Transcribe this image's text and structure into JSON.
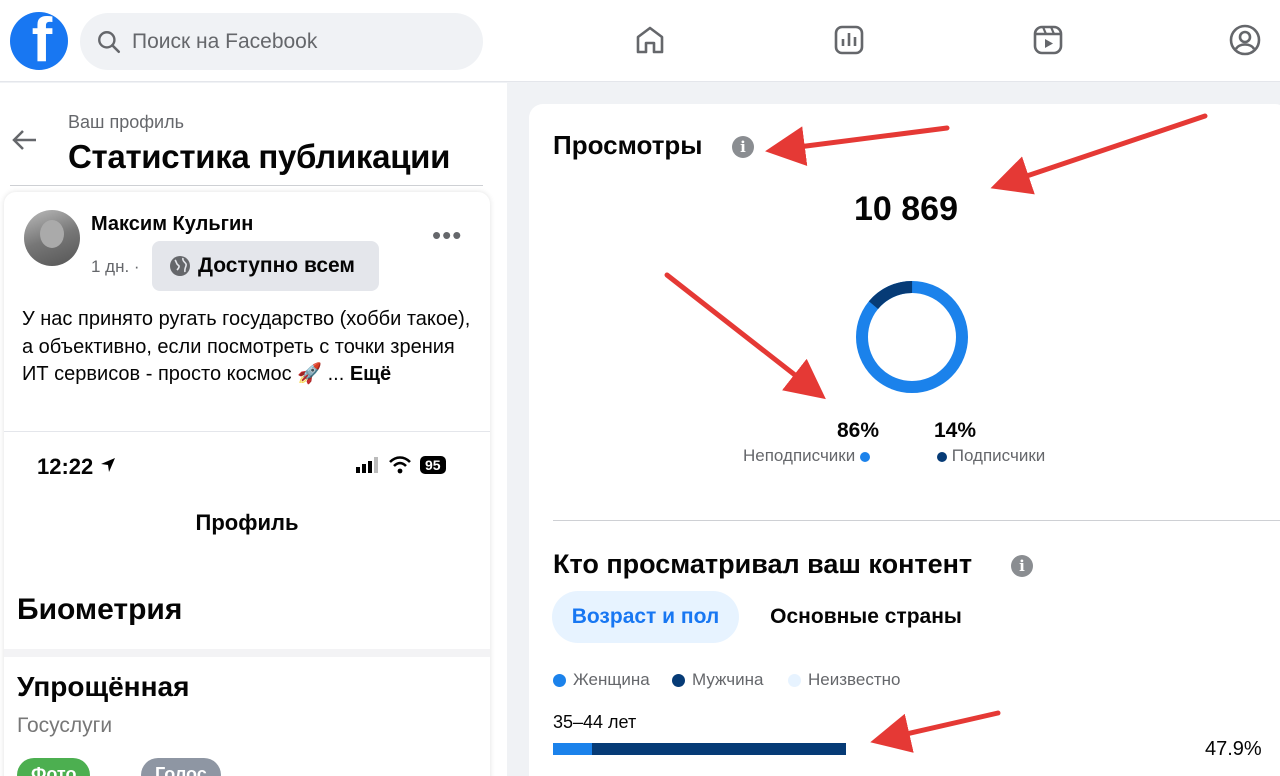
{
  "topbar": {
    "logo_letter": "f",
    "search_placeholder": "Поиск на Facebook",
    "nav_icons": [
      "home-icon",
      "insights-icon",
      "reels-icon",
      "profile-icon"
    ]
  },
  "left": {
    "breadcrumb": "Ваш профиль",
    "title": "Статистика публикации",
    "post": {
      "author": "Максим Кульгин",
      "time": "1 дн. ·",
      "audience": "Доступно всем",
      "text": "У нас принято ругать государство (хобби такое), а объективно, если посмотреть с точки зрения ИТ сервисов - просто космос 🚀 ... ",
      "more": "Ещё",
      "screenshot": {
        "time": "12:22",
        "battery": "95",
        "header": "Профиль",
        "section": "Биометрия",
        "subsection": "Упрощённая",
        "provider": "Госуслуги",
        "chips": [
          "Фото",
          "Голос"
        ]
      }
    }
  },
  "right": {
    "views_title": "Просмотры",
    "views_total": "10 869",
    "non_followers_pct": "86%",
    "non_followers_label": "Неподписчики",
    "followers_pct": "14%",
    "followers_label": "Подписчики",
    "donut": {
      "non_followers": 86,
      "followers": 14
    },
    "who_title": "Кто просматривал ваш контент",
    "tabs": [
      "Возраст и пол",
      "Основные страны"
    ],
    "gender_legend": [
      "Женщина",
      "Мужчина",
      "Неизвестно"
    ],
    "age_group": {
      "label": "35–44 лет",
      "pct": "47.9%",
      "female_share": 0.133,
      "male_share": 0.867
    }
  },
  "colors": {
    "accent": "#1877f2",
    "female": "#1b82eb",
    "male": "#063b76",
    "unknown": "#e7f3ff",
    "arrow": "#e53935"
  }
}
